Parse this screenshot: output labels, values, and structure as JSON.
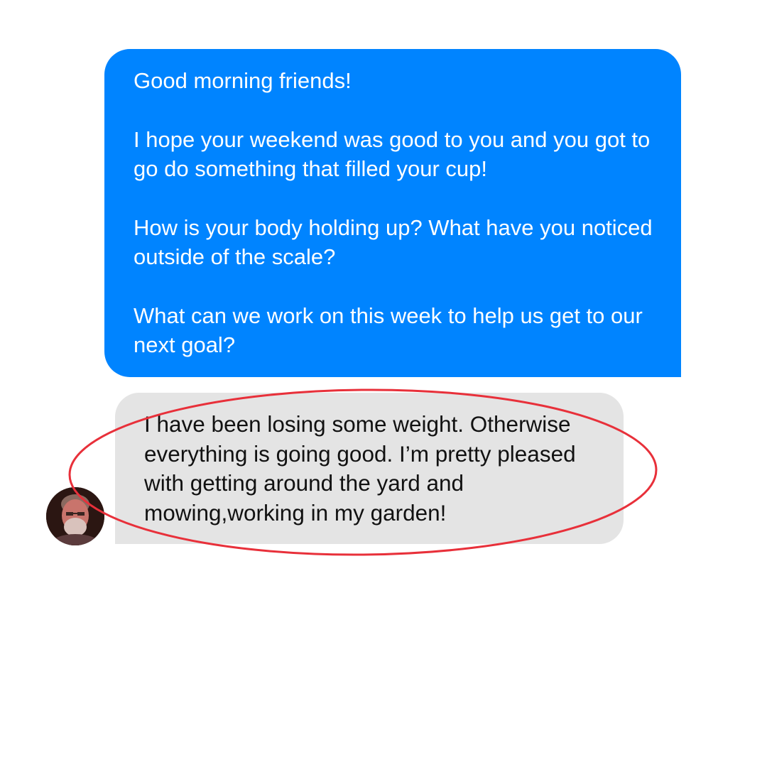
{
  "conversation": {
    "outgoing_message": {
      "paragraphs": [
        "Good morning friends!",
        "I hope your weekend was good to you and you got to go do something that filled your cup!",
        "How is your body holding up? What have you noticed outside of the scale?",
        "What can we work on this week to help us get to our next goal?"
      ]
    },
    "incoming_message": {
      "text": "I have been losing some weight. Otherwise everything is going good. I’m pretty pleased with getting around the yard and mowing,working in my garden!"
    }
  },
  "colors": {
    "outgoing_bubble": "#0084ff",
    "incoming_bubble": "#e4e4e4",
    "highlight_circle": "#e8303a"
  }
}
